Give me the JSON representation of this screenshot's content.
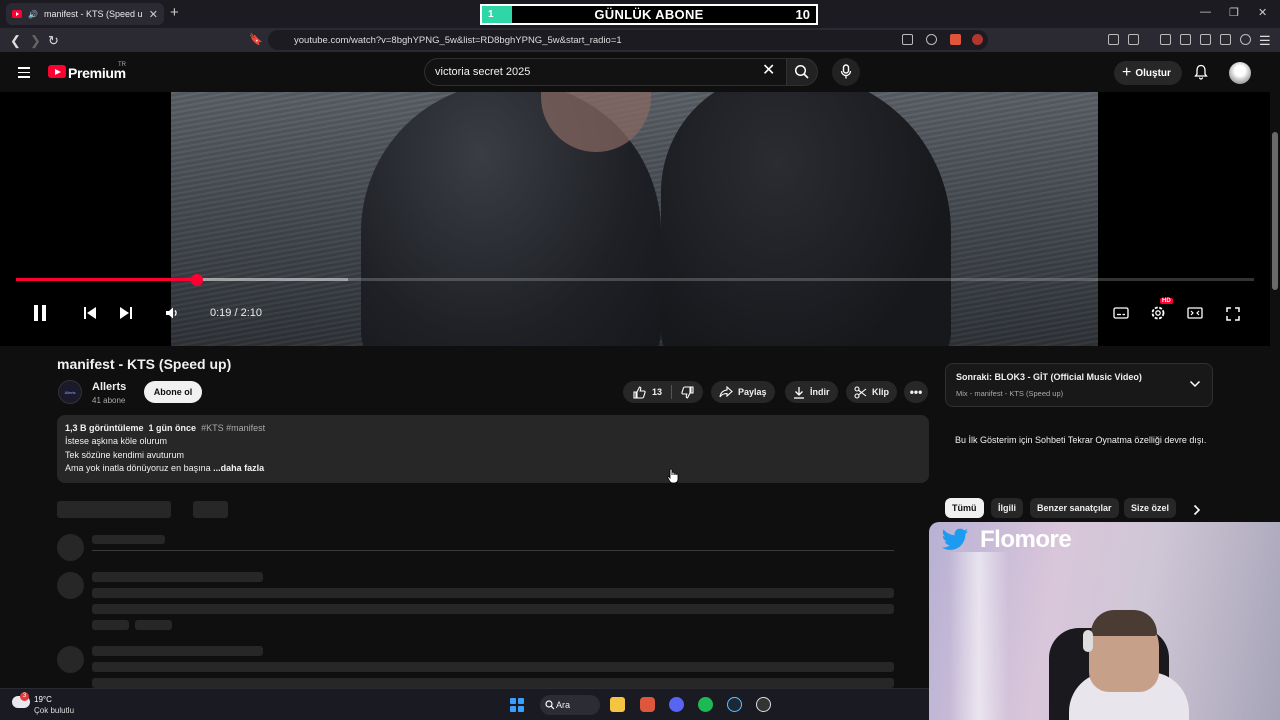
{
  "browser": {
    "tab_title": "manifest - KTS (Speed up) - Y",
    "url": "youtube.com/watch?v=8bghYPNG_5w&list=RD8bghYPNG_5w&start_radio=1"
  },
  "sub_banner": {
    "fill_value": "1",
    "label": "GÜNLÜK ABONE",
    "count": "10",
    "progress": 0.1
  },
  "header": {
    "logo_text": "Premium",
    "country": "TR",
    "search_value": "victoria secret 2025",
    "create_label": "Oluştur"
  },
  "player": {
    "time": "0:19 / 2:10",
    "progress": 0.146,
    "buffered": 0.268,
    "hd_badge": "HD"
  },
  "video": {
    "title": "manifest - KTS (Speed up)",
    "channel_name": "Allerts",
    "channel_avatar_text": "Allerts",
    "channel_subs": "41 abone",
    "subscribe_label": "Abone ol",
    "likes": "13",
    "share_label": "Paylaş",
    "download_label": "İndir",
    "clip_label": "Klip"
  },
  "description": {
    "views": "1,3 B görüntüleme",
    "age": "1 gün önce",
    "tags": "#KTS #manifest",
    "line1": "İstese aşkına köle olurum",
    "line2": "Tek sözüne kendimi avuturum",
    "line3": "Ama yok inatla dönüyoruz en başına",
    "more": "...daha fazla"
  },
  "sidebar": {
    "next_title": "Sonraki: BLOK3 - GİT (Official Music Video)",
    "next_subtitle": "Mix - manifest - KTS (Speed up)",
    "chat_disabled": "Bu İlk Gösterim için Sohbeti Tekrar Oynatma özelliği devre dışı.",
    "chips": [
      "Tümü",
      "İlgili",
      "Benzer sanatçılar",
      "Size özel"
    ]
  },
  "overlay": {
    "streamer_name": "Flomore"
  },
  "taskbar": {
    "temperature": "19°C",
    "condition": "Çok bulutlu",
    "weather_badge": "3",
    "search_label": "Ara"
  },
  "colors": {
    "accent": "#ff0033",
    "banner_fill": "#2fd7a8",
    "background": "#0f0f0f"
  }
}
